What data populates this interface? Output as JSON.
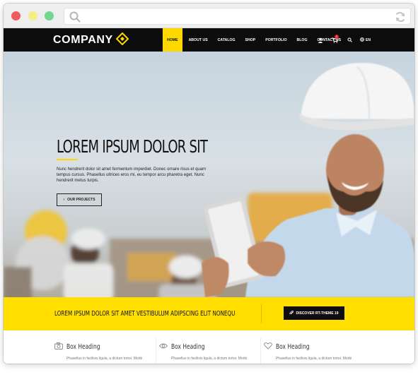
{
  "browser": {
    "search_icon": "search-icon",
    "reload_icon": "reload-icon"
  },
  "nav": {
    "logo": "COMPANY",
    "items": [
      "HOME",
      "ABOUT US",
      "CATALOG",
      "SHOP",
      "PORTFOLIO",
      "BLOG",
      "CONTACT US"
    ],
    "active": "HOME",
    "cart_count": "1",
    "language": "EN"
  },
  "hero": {
    "title": "LOREM IPSUM DOLOR SIT",
    "text": "Nunc hendrerit dolor sit amet fermentum imperdiet. Donec ornare risus et quam tempus cursus. Phasellus ultrices eros mi, eu tempor arcu pharetra eget. Nunc hendrerit metus turpis.",
    "button": "OUR PROJECTS"
  },
  "cta": {
    "text": "LOREM IPSUM DOLOR SIT AMET VESTIBULUM ADIPSCING ELIT NONEQU",
    "button": "DISCOVER RT-THEME 19"
  },
  "boxes": [
    {
      "icon": "camera-icon",
      "title": "Box Heading",
      "text": "Phasellus in facilisis ligula, a dictum tortor. Morbi"
    },
    {
      "icon": "eye-icon",
      "title": "Box Heading",
      "text": "Phasellus in facilisis ligula, a dictum tortor. Morbi"
    },
    {
      "icon": "heart-icon",
      "title": "Box Heading",
      "text": "Phasellus in facilisis ligula, a dictum tortor. Morbi"
    }
  ],
  "colors": {
    "accent": "#ffde00",
    "nav_background": "#0c0c0c"
  }
}
